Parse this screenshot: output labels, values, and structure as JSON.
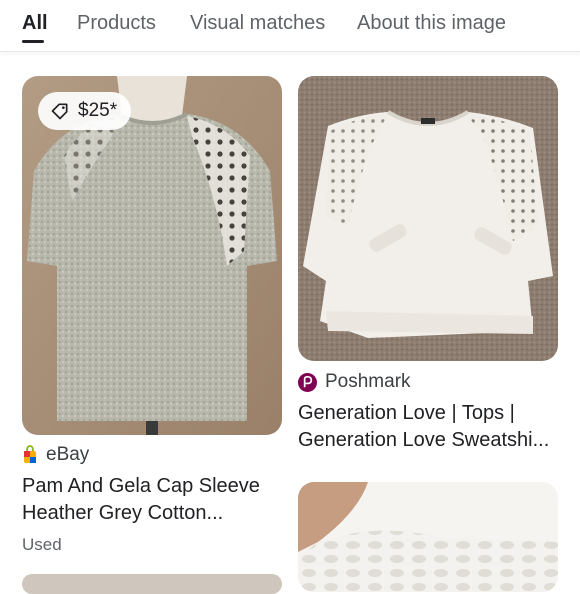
{
  "tabs": [
    {
      "label": "All"
    },
    {
      "label": "Products"
    },
    {
      "label": "Visual matches"
    },
    {
      "label": "About this image"
    }
  ],
  "results": [
    {
      "price": "$25*",
      "source": "eBay",
      "title_line1": "Pam And Gela Cap Sleeve",
      "title_line2": "Heather Grey Cotton...",
      "condition": "Used"
    },
    {
      "source": "Poshmark",
      "title_line1": "Generation Love | Tops |",
      "title_line2": "Generation Love Sweatshi..."
    }
  ],
  "colors": {
    "ebay_red": "#e53238",
    "ebay_blue": "#0064d2",
    "ebay_yellow": "#f5af02",
    "ebay_green": "#86b817",
    "poshmark": "#7f0353"
  }
}
